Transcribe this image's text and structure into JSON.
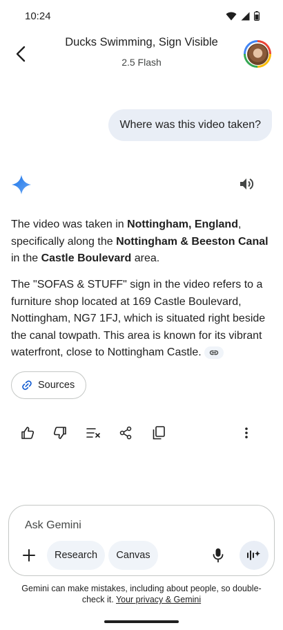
{
  "status_bar": {
    "time": "10:24"
  },
  "header": {
    "title": "Ducks Swimming, Sign Visible",
    "model": "2.5 Flash"
  },
  "user_message": "Where was this video taken?",
  "response": {
    "p1": [
      {
        "text": "The video was taken in ",
        "bold": false
      },
      {
        "text": "Nottingham, England",
        "bold": true
      },
      {
        "text": ", specifically along the ",
        "bold": false
      },
      {
        "text": "Nottingham & Beeston Canal",
        "bold": true
      },
      {
        "text": " in the ",
        "bold": false
      },
      {
        "text": "Castle Boulevard",
        "bold": true
      },
      {
        "text": " area.",
        "bold": false
      }
    ],
    "p2": "The \"SOFAS & STUFF\" sign in the video refers to a furniture shop located at 169 Castle Boulevard, Nottingham, NG7 1FJ, which is situated right beside the canal towpath. This area is known for its vibrant waterfront, close to Nottingham Castle.",
    "sources_label": "Sources"
  },
  "input": {
    "placeholder": "Ask Gemini",
    "chips": [
      "Research",
      "Canvas"
    ]
  },
  "disclaimer": {
    "text": "Gemini can make mistakes, including about people, so double-check it. ",
    "link": "Your privacy & Gemini"
  },
  "icons": [
    "back-arrow-icon",
    "speaker-icon",
    "gemini-spark-icon",
    "link-icon",
    "thumbs-up-icon",
    "thumbs-down-icon",
    "modify-response-icon",
    "share-icon",
    "copy-icon",
    "more-vert-icon",
    "plus-icon",
    "mic-icon",
    "live-icon"
  ]
}
